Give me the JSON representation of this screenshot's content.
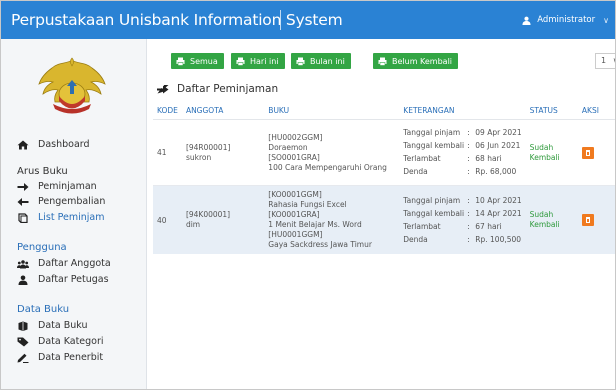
{
  "app": {
    "title": "Perpustakaan Unisbank Information System",
    "user": "Administrator"
  },
  "sidebar": {
    "dashboard": "Dashboard",
    "arus_buku": {
      "heading": "Arus Buku",
      "items": [
        "Peminjaman",
        "Pengembalian",
        "List Peminjam"
      ]
    },
    "pengguna": {
      "heading": "Pengguna",
      "items": [
        "Daftar Anggota",
        "Daftar Petugas"
      ]
    },
    "data_buku": {
      "heading": "Data Buku",
      "items": [
        "Data Buku",
        "Data Kategori",
        "Data Penerbit"
      ]
    }
  },
  "filters": [
    "Semua",
    "Hari ini",
    "Bulan ini",
    "Belum Kembali"
  ],
  "page_size": "1",
  "section_title": "Daftar Peminjaman",
  "table": {
    "headers": [
      "KODE",
      "ANGGOTA",
      "BUKU",
      "KETERANGAN",
      "STATUS",
      "AKSI"
    ],
    "rows": [
      {
        "kode": "41",
        "anggota": [
          "[94R00001]",
          "sukron"
        ],
        "buku": [
          "[HU0002GGM]",
          "Doraemon",
          "[SO0001GRA]",
          "100 Cara Mempengaruhi Orang"
        ],
        "keterangan": [
          [
            "Tanggal pinjam",
            ":",
            "09 Apr 2021"
          ],
          [
            "Tanggal kembali",
            ":",
            "06 Jun 2021"
          ],
          [
            "Terlambat",
            ":",
            "68 hari"
          ],
          [
            "Denda",
            ":",
            "Rp. 68,000"
          ]
        ],
        "status": [
          "Sudah",
          "Kembali"
        ]
      },
      {
        "kode": "40",
        "anggota": [
          "[94K00001]",
          "dim"
        ],
        "buku": [
          "[KO0001GGM]",
          "Rahasia Fungsi Excel",
          "[KO0001GRA]",
          "1 Menit Belajar Ms. Word",
          "[HU0001GGM]",
          "Gaya Sackdress Jawa Timur"
        ],
        "keterangan": [
          [
            "Tanggal pinjam",
            ":",
            "10 Apr 2021"
          ],
          [
            "Tanggal kembali",
            ":",
            "14 Apr 2021"
          ],
          [
            "Terlambat",
            ":",
            "67 hari"
          ],
          [
            "Denda",
            ":",
            "Rp. 100,500"
          ]
        ],
        "status": [
          "Sudah",
          "Kembali"
        ]
      }
    ]
  },
  "colors": {
    "topbar": "#2a82d4",
    "button": "#33a544",
    "link": "#2a6fb8",
    "status": "#2f9a3c",
    "action": "#f07a1f",
    "row_alt": "#e7eef6"
  }
}
